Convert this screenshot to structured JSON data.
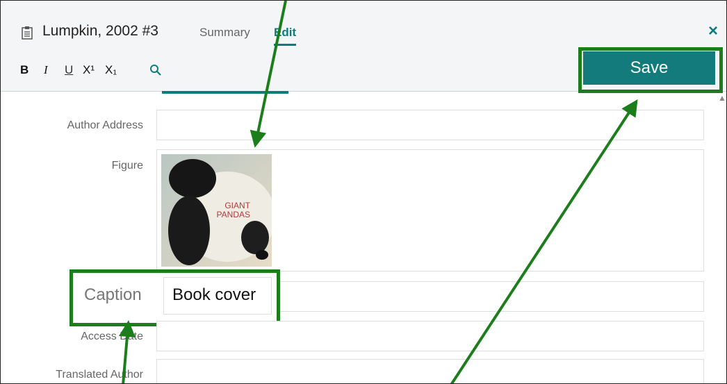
{
  "header": {
    "reference_title": "Lumpkin, 2002 #3",
    "tabs": [
      {
        "label": "Summary",
        "active": false
      },
      {
        "label": "Edit",
        "active": true
      }
    ],
    "close_label": "×"
  },
  "toolbar": {
    "bold": "B",
    "italic": "I",
    "underline": "U",
    "superscript": "X¹",
    "subscript": "X₁",
    "save_label": "Save"
  },
  "fields": {
    "author_address": {
      "label": "Author Address",
      "value": ""
    },
    "figure": {
      "label": "Figure",
      "image_text_1": "GIANT",
      "image_text_2": "PANDAS"
    },
    "caption": {
      "label": "Caption",
      "value": "Book cover"
    },
    "access_date": {
      "label": "Access Date",
      "value": ""
    },
    "translated_author": {
      "label": "Translated Author",
      "value": ""
    }
  },
  "colors": {
    "accent": "#137b7b",
    "highlight": "#1b7e1b"
  },
  "icons": {
    "doc": "clipboard-icon",
    "search": "search-icon",
    "close": "close-icon"
  }
}
